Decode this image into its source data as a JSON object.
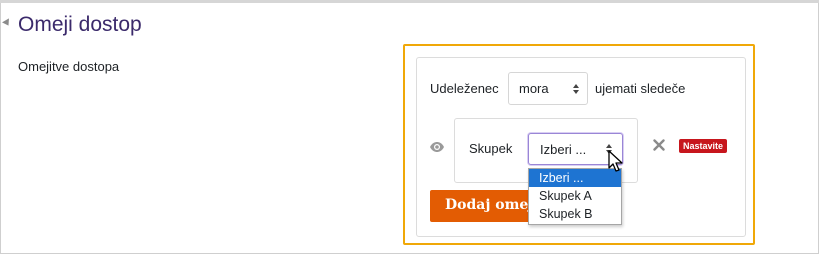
{
  "section": {
    "title": "Omeji dostop",
    "field_label": "Omejitve dostopa"
  },
  "restriction": {
    "prefix_label": "Udeleženec",
    "mode_select": {
      "value": "mora"
    },
    "suffix_label": "ujemati sledeče",
    "condition": {
      "type_label": "Skupek",
      "group_select": {
        "value": "Izberi ...",
        "options": [
          "Izberi ...",
          "Skupek A",
          "Skupek B"
        ],
        "selected_index": 0
      },
      "badge": "Nastavite"
    },
    "add_button_label": "Dodaj omejitev..."
  },
  "colors": {
    "title": "#3b2a6b",
    "highlight_border": "#f0a808",
    "add_button": "#e35c03",
    "badge": "#c7161d",
    "selected_option": "#1e74d2"
  },
  "icons": [
    "collapse-caret-icon",
    "eye-icon",
    "close-icon",
    "updown-arrow-icon",
    "mouse-cursor-icon"
  ]
}
